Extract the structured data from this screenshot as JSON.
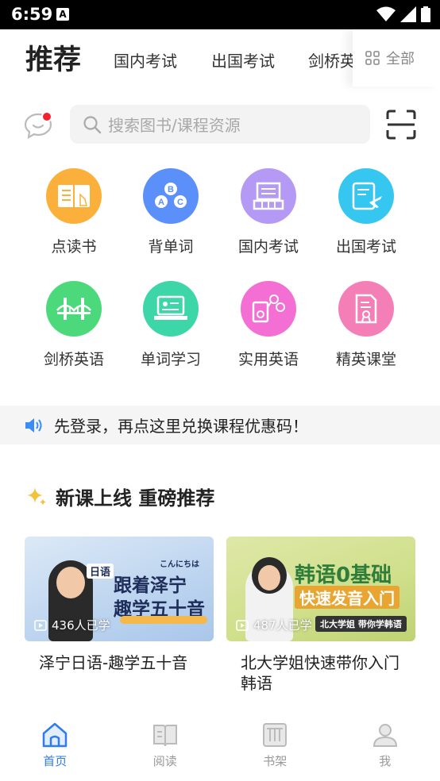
{
  "status_bar": {
    "time": "6:59",
    "notif_letter": "A"
  },
  "top_tabs": {
    "main": "推荐",
    "tabs": [
      "国内考试",
      "出国考试",
      "剑桥英语"
    ],
    "all_label": "全部"
  },
  "search": {
    "placeholder": "搜索图书/课程资源"
  },
  "categories": [
    {
      "label": "点读书",
      "color": "#fbb03b",
      "icon": "book-reader-icon"
    },
    {
      "label": "背单词",
      "color": "#5b8ff9",
      "icon": "abc-letters-icon"
    },
    {
      "label": "国内考试",
      "color": "#b59af5",
      "icon": "building-exam-icon"
    },
    {
      "label": "出国考试",
      "color": "#36c7f0",
      "icon": "plane-document-icon"
    },
    {
      "label": "剑桥英语",
      "color": "#4cd97b",
      "icon": "bridge-icon"
    },
    {
      "label": "单词学习",
      "color": "#3dd6a8",
      "icon": "laptop-card-icon"
    },
    {
      "label": "实用英语",
      "color": "#f36fd4",
      "icon": "media-player-icon"
    },
    {
      "label": "精英课堂",
      "color": "#f47fb6",
      "icon": "certificate-icon"
    }
  ],
  "notice": {
    "text": "先登录，再点这里兑换课程优惠码！"
  },
  "section": {
    "title": "新课上线 重磅推荐"
  },
  "courses": [
    {
      "title": "泽宁日语-趣学五十音",
      "count": "436人已学",
      "thumb_tag": "日语",
      "thumb_line1": "跟着泽宁",
      "thumb_line2": "趣学五十音",
      "thumb_hello": "こんにちは"
    },
    {
      "title": "北大学姐快速带你入门韩语",
      "count": "487人已学",
      "thumb_line1": "韩语0基础",
      "thumb_line2": "快速发音入门",
      "thumb_banner": "北大学姐 带你学韩语"
    }
  ],
  "nav": [
    {
      "label": "首页",
      "icon": "home-icon",
      "active": true
    },
    {
      "label": "阅读",
      "icon": "open-book-icon",
      "active": false
    },
    {
      "label": "书架",
      "icon": "bookshelf-icon",
      "active": false
    },
    {
      "label": "我",
      "icon": "user-icon",
      "active": false
    }
  ],
  "colors": {
    "accent": "#2f7bf0",
    "notice_speaker": "#3b8cf5",
    "badge_red": "#f5222d"
  }
}
